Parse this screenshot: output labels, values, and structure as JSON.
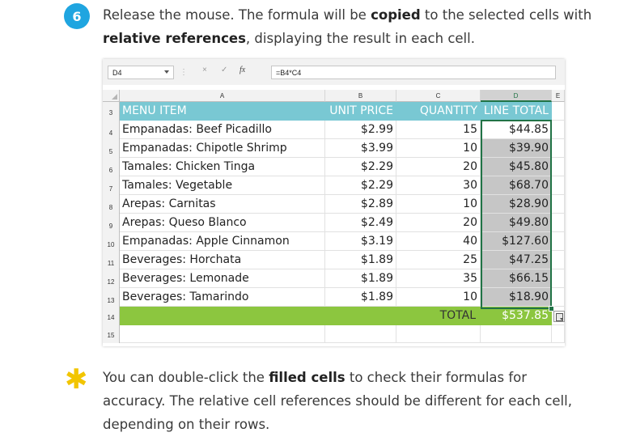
{
  "step": {
    "number": "6",
    "text_1": "Release the mouse. The formula will be ",
    "bold_1": "copied",
    "text_2": " to the selected cells with ",
    "bold_2": "relative references",
    "text_3": ", displaying the result in each cell."
  },
  "formula_bar": {
    "name_box": "D4",
    "cancel_icon": "×",
    "enter_icon": "✓",
    "fx_label": "fx",
    "formula": "=B4*C4"
  },
  "columns": [
    "A",
    "B",
    "C",
    "D",
    "E"
  ],
  "rows": [
    "3",
    "4",
    "5",
    "6",
    "7",
    "8",
    "9",
    "10",
    "11",
    "12",
    "13",
    "14",
    "15"
  ],
  "header": {
    "item": "MENU ITEM",
    "unit_price": "UNIT PRICE",
    "quantity": "QUANTITY",
    "line_total": "LINE TOTAL"
  },
  "items": [
    {
      "name": "Empanadas: Beef Picadillo",
      "price": "$2.99",
      "qty": "15",
      "total": "$44.85"
    },
    {
      "name": "Empanadas: Chipotle Shrimp",
      "price": "$3.99",
      "qty": "10",
      "total": "$39.90"
    },
    {
      "name": "Tamales: Chicken Tinga",
      "price": "$2.29",
      "qty": "20",
      "total": "$45.80"
    },
    {
      "name": "Tamales: Vegetable",
      "price": "$2.29",
      "qty": "30",
      "total": "$68.70"
    },
    {
      "name": "Arepas: Carnitas",
      "price": "$2.89",
      "qty": "10",
      "total": "$28.90"
    },
    {
      "name": "Arepas: Queso Blanco",
      "price": "$2.49",
      "qty": "20",
      "total": "$49.80"
    },
    {
      "name": "Empanadas: Apple Cinnamon",
      "price": "$3.19",
      "qty": "40",
      "total": "$127.60"
    },
    {
      "name": "Beverages: Horchata",
      "price": "$1.89",
      "qty": "25",
      "total": "$47.25"
    },
    {
      "name": "Beverages: Lemonade",
      "price": "$1.89",
      "qty": "35",
      "total": "$66.15"
    },
    {
      "name": "Beverages: Tamarindo",
      "price": "$1.89",
      "qty": "10",
      "total": "$18.90"
    }
  ],
  "total": {
    "label": "TOTAL",
    "value": "$537.85"
  },
  "tip": {
    "text_1": "You can double-click the ",
    "bold_1": "filled cells",
    "text_2": " to check their formulas for accuracy. The relative cell references should be different for each cell, depending on their rows."
  },
  "colors": {
    "step_badge": "#1fa5e0",
    "header_fill": "#79c8d3",
    "total_fill": "#8cc63f",
    "selection_border": "#217346",
    "tip_star": "#f2c500"
  }
}
